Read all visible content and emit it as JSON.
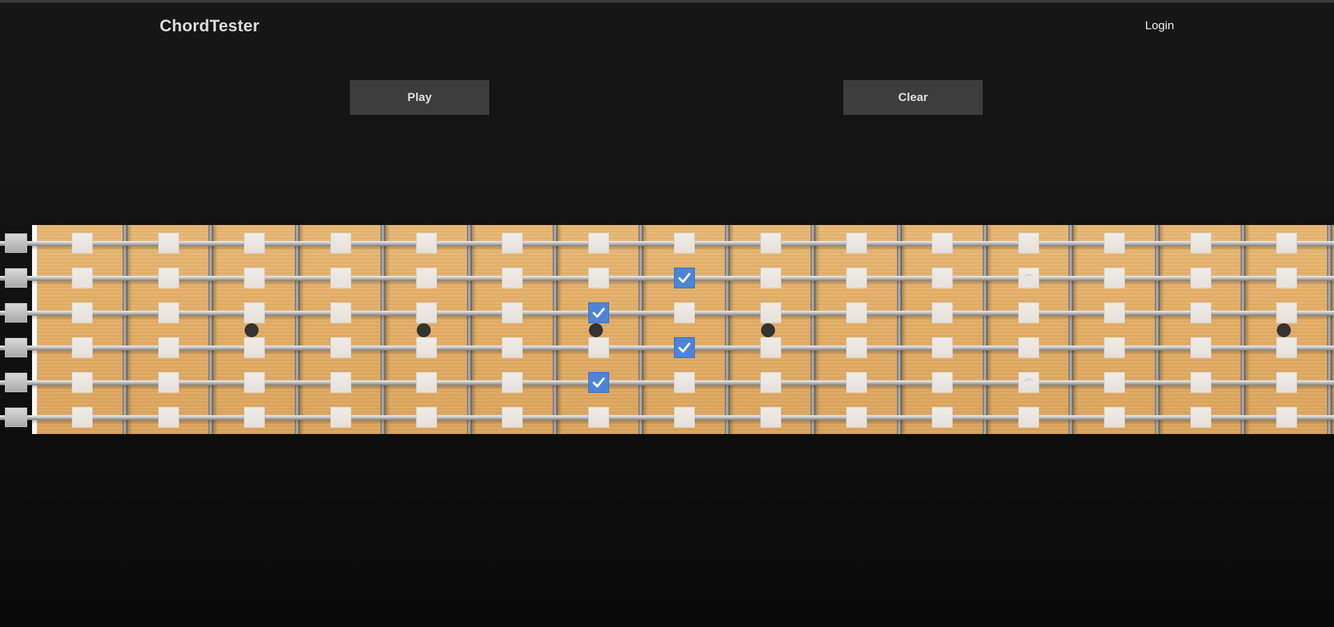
{
  "app": {
    "title": "ChordTester",
    "login_label": "Login"
  },
  "controls": {
    "play_label": "Play",
    "clear_label": "Clear"
  },
  "fretboard": {
    "strings": 6,
    "frets": 15,
    "inlay_frets": [
      3,
      5,
      7,
      9,
      15
    ],
    "checked": [
      {
        "string": 2,
        "fret": 8
      },
      {
        "string": 3,
        "fret": 7
      },
      {
        "string": 4,
        "fret": 8
      },
      {
        "string": 5,
        "fret": 7
      }
    ],
    "faded": [
      {
        "string": 2,
        "fret": 12
      },
      {
        "string": 5,
        "fret": 12
      }
    ],
    "colors": {
      "wood": "#e3ad65",
      "check": "#4c84d8",
      "inlay": "#333333",
      "background": "#121212"
    }
  }
}
